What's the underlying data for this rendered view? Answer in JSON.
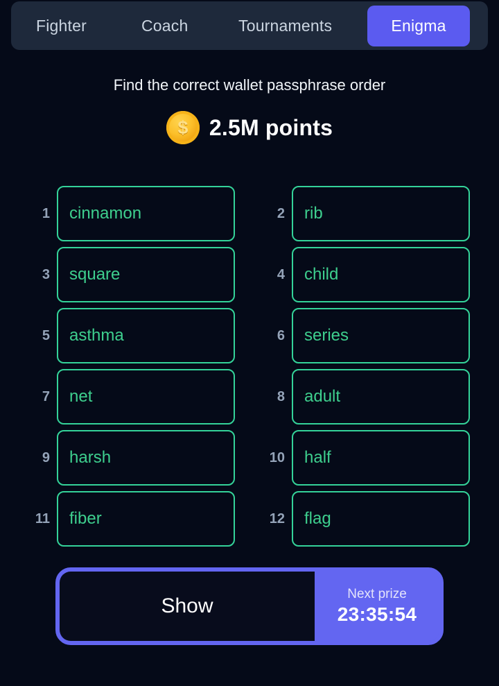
{
  "nav": {
    "tabs": [
      {
        "label": "Fighter",
        "active": false
      },
      {
        "label": "Coach",
        "active": false
      },
      {
        "label": "Tournaments",
        "active": false
      },
      {
        "label": "Enigma",
        "active": true
      }
    ]
  },
  "header": {
    "subtitle": "Find the correct wallet passphrase order",
    "coin_icon": "coin-dollar-icon",
    "coin_glyph": "$",
    "points": "2.5M points"
  },
  "puzzle": {
    "words": [
      {
        "number": "1",
        "word": "cinnamon"
      },
      {
        "number": "2",
        "word": "rib"
      },
      {
        "number": "3",
        "word": "square"
      },
      {
        "number": "4",
        "word": "child"
      },
      {
        "number": "5",
        "word": "asthma"
      },
      {
        "number": "6",
        "word": "series"
      },
      {
        "number": "7",
        "word": "net"
      },
      {
        "number": "8",
        "word": "adult"
      },
      {
        "number": "9",
        "word": "harsh"
      },
      {
        "number": "10",
        "word": "half"
      },
      {
        "number": "11",
        "word": "fiber"
      },
      {
        "number": "12",
        "word": "flag"
      }
    ]
  },
  "actions": {
    "show_label": "Show",
    "prize_label": "Next prize",
    "prize_time": "23:35:54"
  },
  "colors": {
    "background": "#050a18",
    "navbar": "#1e293b",
    "accent_purple": "#6366f1",
    "active_tab": "#5b5bf0",
    "word_border": "#34d399",
    "word_text": "#3ecf8e",
    "number_text": "#94a3b8",
    "coin_gold": "#f0a413"
  }
}
